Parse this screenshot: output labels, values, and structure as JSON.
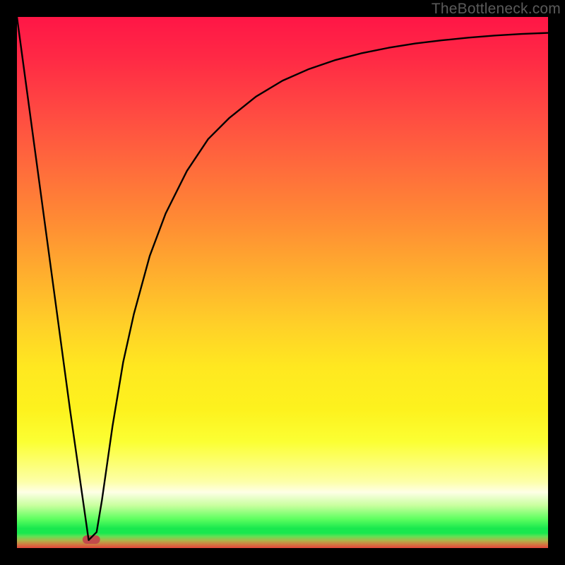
{
  "watermark": {
    "text": "TheBottleneck.com"
  },
  "chart_data": {
    "type": "line",
    "title": "",
    "xlabel": "",
    "ylabel": "",
    "xlim": [
      0,
      100
    ],
    "ylim": [
      0,
      100
    ],
    "grid": false,
    "legend": false,
    "series": [
      {
        "name": "bottleneck-curve",
        "x": [
          0,
          5,
          10,
          13.5,
          15,
          16,
          17,
          18,
          20,
          22,
          25,
          28,
          32,
          36,
          40,
          45,
          50,
          55,
          60,
          65,
          70,
          75,
          80,
          85,
          90,
          95,
          100
        ],
        "values": [
          100,
          63,
          26,
          1.5,
          3,
          9,
          16,
          23,
          35,
          44,
          55,
          63,
          71,
          77,
          81,
          85,
          88,
          90.2,
          91.9,
          93.2,
          94.2,
          95.0,
          95.6,
          96.1,
          96.5,
          96.8,
          97.0
        ]
      }
    ],
    "marker": {
      "name": "optimal-zone",
      "x": 14.0,
      "width": 3.3,
      "color": "#c24a4b"
    },
    "gradient_stops": [
      {
        "pos": 0.0,
        "color": "#ff1646"
      },
      {
        "pos": 0.4,
        "color": "#ff8a34"
      },
      {
        "pos": 0.74,
        "color": "#fdf21e"
      },
      {
        "pos": 0.895,
        "color": "#feffe6"
      },
      {
        "pos": 0.965,
        "color": "#19e84e"
      },
      {
        "pos": 1.0,
        "color": "#e2453c"
      }
    ]
  }
}
